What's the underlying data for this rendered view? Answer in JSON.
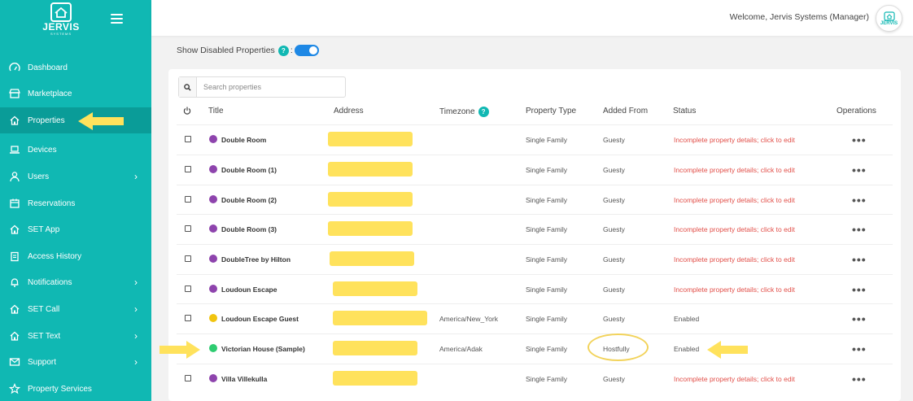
{
  "app": {
    "brand": "JERVIS",
    "brand_sub": "SYSTEMS",
    "welcome": "Welcome, Jervis Systems (Manager)",
    "avatar_brand": "JERVIS"
  },
  "sidebar": {
    "items": [
      {
        "label": "Dashboard",
        "icon": "dashboard-icon",
        "chevron": false
      },
      {
        "label": "Marketplace",
        "icon": "store-icon",
        "chevron": false
      },
      {
        "label": "Properties",
        "icon": "home-icon",
        "chevron": false,
        "active": true
      },
      {
        "label": "Devices",
        "icon": "laptop-icon",
        "chevron": false
      },
      {
        "label": "Users",
        "icon": "user-icon",
        "chevron": true
      },
      {
        "label": "Reservations",
        "icon": "calendar-icon",
        "chevron": false
      },
      {
        "label": "SET App",
        "icon": "home-icon",
        "chevron": false
      },
      {
        "label": "Access History",
        "icon": "clipboard-icon",
        "chevron": false
      },
      {
        "label": "Notifications",
        "icon": "bell-icon",
        "chevron": true
      },
      {
        "label": "SET Call",
        "icon": "home-icon",
        "chevron": true
      },
      {
        "label": "SET Text",
        "icon": "home-icon",
        "chevron": true
      },
      {
        "label": "Support",
        "icon": "mail-icon",
        "chevron": true
      },
      {
        "label": "Property Services",
        "icon": "star-icon",
        "chevron": false
      }
    ]
  },
  "filters": {
    "show_disabled_label": "Show Disabled Properties",
    "help": "?",
    "colon": ":",
    "show_disabled_on": true
  },
  "search": {
    "placeholder": "Search properties"
  },
  "table": {
    "headers": {
      "title": "Title",
      "address": "Address",
      "timezone": "Timezone",
      "timezone_help": "?",
      "property_type": "Property Type",
      "added_from": "Added From",
      "status": "Status",
      "operations": "Operations"
    },
    "rows": [
      {
        "title": "Double Room",
        "dot": "#8e44ad",
        "timezone": "",
        "type": "Single Family",
        "added_from": "Guesty",
        "status": "Incomplete property details; click to edit",
        "checkbox": true
      },
      {
        "title": "Double Room (1)",
        "dot": "#8e44ad",
        "timezone": "",
        "type": "Single Family",
        "added_from": "Guesty",
        "status": "Incomplete property details; click to edit",
        "checkbox": true
      },
      {
        "title": "Double Room (2)",
        "dot": "#8e44ad",
        "timezone": "",
        "type": "Single Family",
        "added_from": "Guesty",
        "status": "Incomplete property details; click to edit",
        "checkbox": true
      },
      {
        "title": "Double Room (3)",
        "dot": "#8e44ad",
        "timezone": "",
        "type": "Single Family",
        "added_from": "Guesty",
        "status": "Incomplete property details; click to edit",
        "checkbox": true
      },
      {
        "title": "DoubleTree by Hilton",
        "dot": "#8e44ad",
        "timezone": "",
        "type": "Single Family",
        "added_from": "Guesty",
        "status": "Incomplete property details; click to edit",
        "checkbox": true
      },
      {
        "title": "Loudoun Escape",
        "dot": "#8e44ad",
        "timezone": "",
        "type": "Single Family",
        "added_from": "Guesty",
        "status": "Incomplete property details; click to edit",
        "checkbox": true
      },
      {
        "title": "Loudoun Escape Guest",
        "dot": "#f1c40f",
        "timezone": "America/New_York",
        "type": "Single Family",
        "added_from": "Guesty",
        "status": "Enabled",
        "checkbox": true
      },
      {
        "title": "Victorian House (Sample)",
        "dot": "#2ecc71",
        "timezone": "America/Adak",
        "type": "Single Family",
        "added_from": "Hostfully",
        "status": "Enabled",
        "checkbox": false
      },
      {
        "title": "Villa Villekulla",
        "dot": "#8e44ad",
        "timezone": "",
        "type": "Single Family",
        "added_from": "Guesty",
        "status": "Incomplete property details; click to edit",
        "checkbox": true
      }
    ],
    "ops_label": "•••"
  },
  "colors": {
    "sidebar": "#10b8b3",
    "sidebar_active": "#0a9c98",
    "toggle": "#1e88e5",
    "status_red": "#e2504a",
    "annotation_yellow": "#ffe25c"
  }
}
